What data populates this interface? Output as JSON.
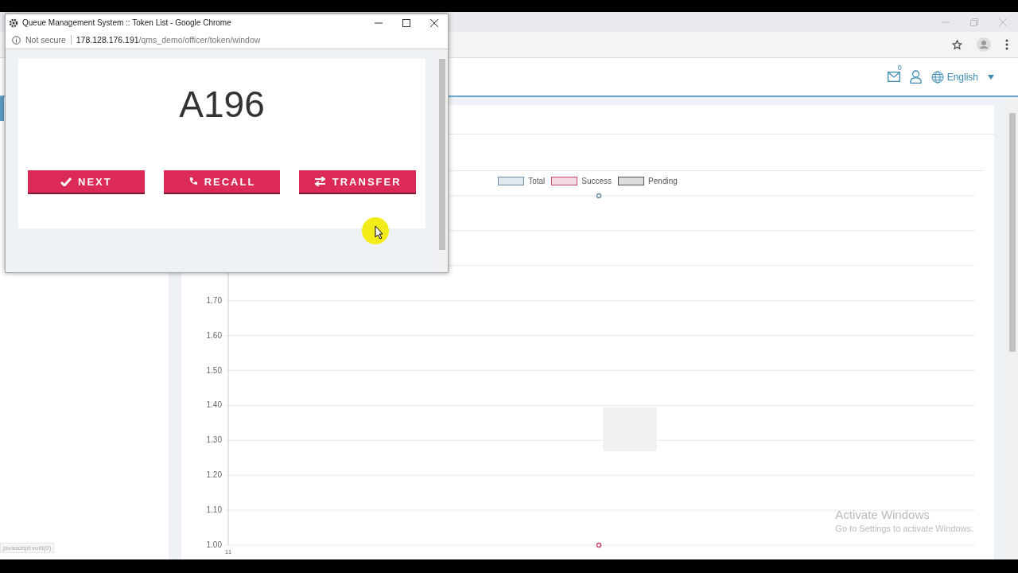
{
  "browser": {
    "header": {
      "mail_badge": "0",
      "language": "English"
    },
    "chart": {
      "x_tick_label": "11",
      "chart_data": {
        "type": "line",
        "grid": true,
        "ylim": [
          1,
          2
        ],
        "yticks": [
          {
            "value": 1,
            "label": "1.00"
          },
          {
            "value": 1.1,
            "label": "1.10"
          },
          {
            "value": 1.2,
            "label": "1.20"
          },
          {
            "value": 1.3,
            "label": "1.30"
          },
          {
            "value": 1.4,
            "label": "1.40"
          },
          {
            "value": 1.5,
            "label": "1.50"
          },
          {
            "value": 1.6,
            "label": "1.60"
          },
          {
            "value": 1.7,
            "label": "1.70"
          }
        ],
        "series": [
          {
            "name": "Total",
            "color": "#6a8ea8",
            "marker": true,
            "values": [
              2
            ]
          },
          {
            "name": "Success",
            "color": "#c8486a",
            "marker": true,
            "values": [
              1
            ]
          },
          {
            "name": "Pending",
            "color": "#555555",
            "values": [
              null
            ]
          }
        ]
      }
    },
    "status_bar": "javascript:void(0)"
  },
  "popup_window": {
    "title": "Queue Management System :: Token List - Google Chrome",
    "address_bar": {
      "security": "Not secure",
      "host": "178.128.176.191",
      "path": "/qms_demo/officer/token/window"
    },
    "token": "A196",
    "buttons": [
      {
        "label": "NEXT",
        "kind": "next"
      },
      {
        "label": "RECALL",
        "kind": "recall"
      },
      {
        "label": "TRANSFER",
        "kind": "transfer"
      }
    ]
  },
  "os_notice": {
    "title": "Activate Windows",
    "text": "Go to Settings to activate Windows."
  }
}
